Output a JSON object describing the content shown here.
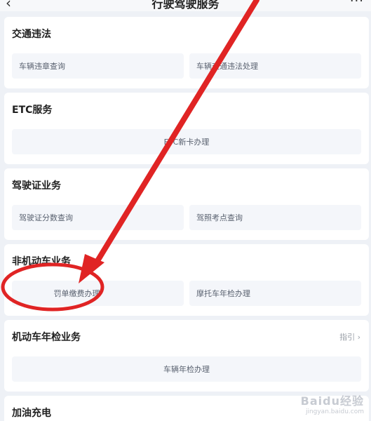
{
  "header": {
    "back_icon": "‹",
    "title": "行驶驾驶服务",
    "more_icon": "···"
  },
  "sections": [
    {
      "title": "交通违法",
      "buttons": [
        "车辆违章查询",
        "车辆交通违法处理"
      ]
    },
    {
      "title": "ETC服务",
      "buttons": [
        "ETC新卡办理"
      ]
    },
    {
      "title": "驾驶证业务",
      "buttons": [
        "驾驶证分数查询",
        "驾照考点查询"
      ]
    },
    {
      "title": "非机动车业务",
      "buttons": [
        "罚单缴费办理",
        "摩托车年检办理"
      ]
    },
    {
      "title": "机动车年检业务",
      "meta": "指引 ›",
      "buttons": [
        "车辆年检办理"
      ]
    },
    {
      "title": "加油充电"
    }
  ],
  "annotation": {
    "arrow_color": "#e02424",
    "circle_color": "#e02424"
  },
  "watermark": {
    "main": "Baidu经验",
    "sub": "jingyan.baidu.com"
  }
}
